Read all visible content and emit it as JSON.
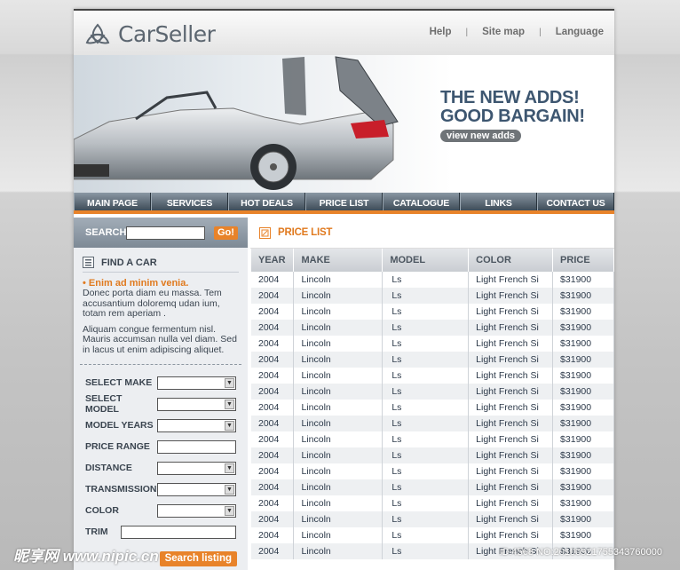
{
  "header": {
    "logo_text": "CarSeller",
    "links": [
      "Help",
      "Site map",
      "Language"
    ]
  },
  "hero": {
    "line1": "THE NEW ADDS!",
    "line2": "GOOD BARGAIN!",
    "button": "view new adds"
  },
  "nav": [
    "MAIN PAGE",
    "SERVICES",
    "HOT DEALS",
    "PRICE LIST",
    "CATALOGUE",
    "LINKS",
    "CONTACT US"
  ],
  "search": {
    "label": "SEARCH",
    "go": "Go!"
  },
  "find_car": {
    "title": "FIND A CAR",
    "head": "Enim ad minim venia.",
    "p1": "Donec porta diam eu massa. Tem accusantium doloremq udan ium, totam rem aperiam .",
    "p2": "Aliquam congue fermentum nisl. Mauris accumsan nulla vel diam. Sed in lacus ut enim adipiscing aliquet."
  },
  "filters": {
    "make": "SELECT MAKE",
    "model": "SELECT MODEL",
    "years": "MODEL YEARS",
    "price": "PRICE RANGE",
    "distance": "DISTANCE",
    "transmission": "TRANSMISSION",
    "color": "COLOR",
    "trim": "TRIM",
    "submit": "Search listing"
  },
  "price_list": {
    "title": "PRICE LIST",
    "columns": [
      "YEAR",
      "MAKE",
      "MODEL",
      "COLOR",
      "PRICE"
    ],
    "rows": [
      [
        "2004",
        "Lincoln",
        "Ls",
        "Light French Si",
        "$31900"
      ],
      [
        "2004",
        "Lincoln",
        "Ls",
        "Light French Si",
        "$31900"
      ],
      [
        "2004",
        "Lincoln",
        "Ls",
        "Light French Si",
        "$31900"
      ],
      [
        "2004",
        "Lincoln",
        "Ls",
        "Light French Si",
        "$31900"
      ],
      [
        "2004",
        "Lincoln",
        "Ls",
        "Light French Si",
        "$31900"
      ],
      [
        "2004",
        "Lincoln",
        "Ls",
        "Light French Si",
        "$31900"
      ],
      [
        "2004",
        "Lincoln",
        "Ls",
        "Light French Si",
        "$31900"
      ],
      [
        "2004",
        "Lincoln",
        "Ls",
        "Light French Si",
        "$31900"
      ],
      [
        "2004",
        "Lincoln",
        "Ls",
        "Light French Si",
        "$31900"
      ],
      [
        "2004",
        "Lincoln",
        "Ls",
        "Light French Si",
        "$31900"
      ],
      [
        "2004",
        "Lincoln",
        "Ls",
        "Light French Si",
        "$31900"
      ],
      [
        "2004",
        "Lincoln",
        "Ls",
        "Light French Si",
        "$31900"
      ],
      [
        "2004",
        "Lincoln",
        "Ls",
        "Light French Si",
        "$31900"
      ],
      [
        "2004",
        "Lincoln",
        "Ls",
        "Light French Si",
        "$31900"
      ],
      [
        "2004",
        "Lincoln",
        "Ls",
        "Light French Si",
        "$31900"
      ],
      [
        "2004",
        "Lincoln",
        "Ls",
        "Light French Si",
        "$31900"
      ],
      [
        "2004",
        "Lincoln",
        "Ls",
        "Light French Si",
        "$31900"
      ],
      [
        "2004",
        "Lincoln",
        "Ls",
        "Light French Si",
        "$31900"
      ]
    ]
  },
  "watermark": {
    "site": "昵享网 www.nipic.cn",
    "id": "ID:4568 NO:20100921755343760000"
  },
  "colors": {
    "accent": "#e8832a",
    "nav_dark": "#3e4c58",
    "text_blue": "#3d5670"
  }
}
